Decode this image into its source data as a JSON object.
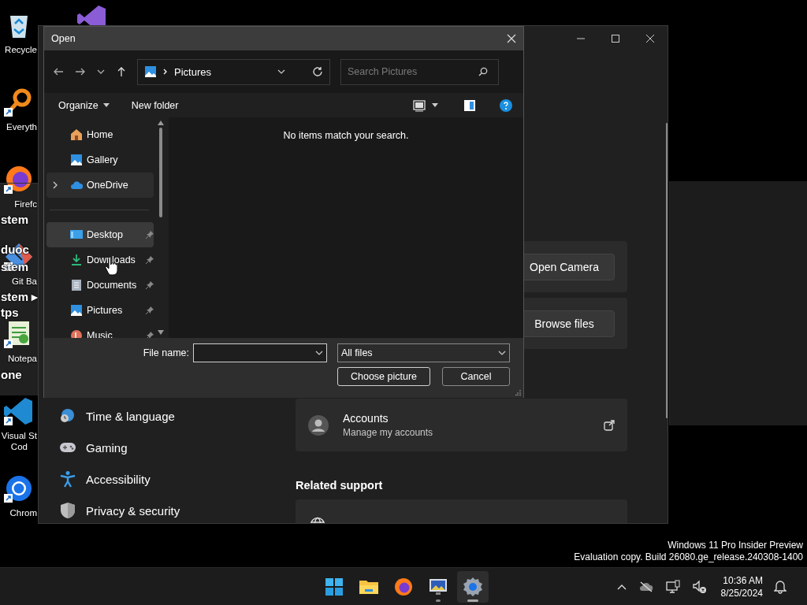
{
  "desktop": {
    "icons": [
      {
        "label": "Recycle",
        "kind": "recycle",
        "shortcut": false
      },
      {
        "label": "Everyth",
        "kind": "search",
        "shortcut": true
      },
      {
        "label": "Firefc",
        "kind": "firefox",
        "shortcut": true
      },
      {
        "label": "Git Ba",
        "kind": "git",
        "shortcut": true
      },
      {
        "label": "Notepa",
        "kind": "notepad",
        "shortcut": true
      },
      {
        "label": "Visual St\nCod",
        "kind": "vscode",
        "shortcut": true
      },
      {
        "label": "Chrom",
        "kind": "chrome",
        "shortcut": true
      },
      {
        "kind": "vs",
        "shortcut": false
      }
    ],
    "background_window": {
      "lines": [
        "stem",
        "duoc",
        "stem",
        "stem ▸",
        "tps",
        "one"
      ]
    },
    "build_info": [
      "Windows 11 Pro Insider Preview",
      "Evaluation copy. Build 26080.ge_release.240308-1400"
    ]
  },
  "settings_window": {
    "nav": [
      {
        "label": "Time & language",
        "kind": "time"
      },
      {
        "label": "Gaming",
        "kind": "gaming"
      },
      {
        "label": "Accessibility",
        "kind": "accessibility"
      },
      {
        "label": "Privacy & security",
        "kind": "privacy"
      }
    ],
    "actions": [
      "Open Camera",
      "Browse files"
    ],
    "accounts_card": {
      "title": "Accounts",
      "subtitle": "Manage my accounts"
    },
    "related_support": "Related support"
  },
  "open_dialog": {
    "title": "Open",
    "address": "Pictures",
    "search": {
      "placeholder": "Search Pictures"
    },
    "toolbar": [
      "Organize",
      "New folder"
    ],
    "sidebar": [
      {
        "label": "Home",
        "kind": "home",
        "expandable": false,
        "pinned": false,
        "selected": false,
        "hovered": false
      },
      {
        "label": "Gallery",
        "kind": "gallery",
        "expandable": false,
        "pinned": false,
        "selected": false,
        "hovered": false
      },
      {
        "label": "OneDrive",
        "kind": "cloud",
        "expandable": true,
        "pinned": false,
        "selected": false,
        "hovered": true
      },
      {
        "kind": "divider"
      },
      {
        "label": "Desktop",
        "kind": "desktop",
        "expandable": false,
        "pinned": true,
        "selected": true,
        "hovered": false
      },
      {
        "label": "Downloads",
        "kind": "downloads",
        "expandable": false,
        "pinned": true,
        "selected": false,
        "hovered": false
      },
      {
        "label": "Documents",
        "kind": "documents",
        "expandable": false,
        "pinned": true,
        "selected": false,
        "hovered": false
      },
      {
        "label": "Pictures",
        "kind": "gallery",
        "expandable": false,
        "pinned": true,
        "selected": false,
        "hovered": false
      },
      {
        "label": "Music",
        "kind": "music",
        "expandable": false,
        "pinned": true,
        "selected": false,
        "hovered": false
      }
    ],
    "empty_message": "No items match your search.",
    "file_name": {
      "label": "File name:"
    },
    "file_type": "All files",
    "buttons": [
      "Choose picture",
      "Cancel"
    ]
  },
  "taskbar": {
    "apps": [
      {
        "kind": "start",
        "active": false,
        "running": false
      },
      {
        "kind": "explorer",
        "active": false,
        "running": false
      },
      {
        "kind": "firefox",
        "active": false,
        "running": false
      },
      {
        "kind": "app",
        "active": false,
        "running": true
      },
      {
        "kind": "settings",
        "active": true,
        "running": true
      }
    ],
    "clock": {
      "time": "10:36 AM",
      "date": "8/25/2024"
    }
  }
}
